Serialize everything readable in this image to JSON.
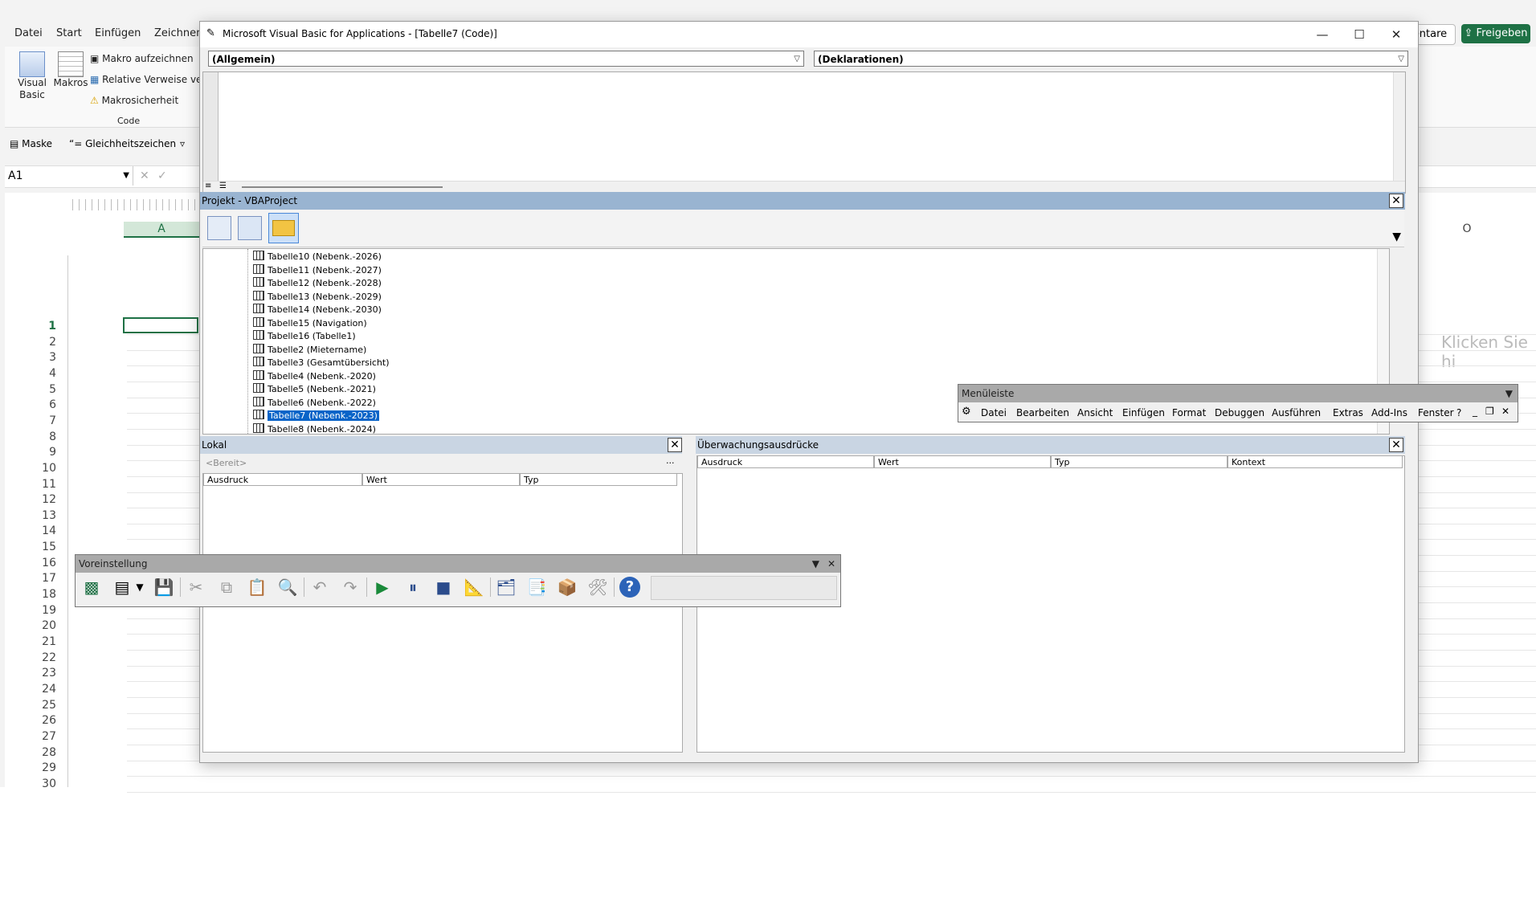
{
  "excel": {
    "tabs": [
      "Datei",
      "Start",
      "Einfügen",
      "Zeichnen"
    ],
    "ribbon": {
      "visual_basic": "Visual\nBasic",
      "makros": "Makros",
      "makro_aufzeichnen": "Makro aufzeichnen",
      "relative_verweise": "Relative Verweise verw",
      "makrosicherheit": "Makrosicherheit",
      "group_code": "Code"
    },
    "quick": {
      "maske": "Maske",
      "gleichheitszeichen": "Gleichheitszeichen"
    },
    "name_box": "A1",
    "column_a": "A",
    "column_o": "O",
    "kommentare": "entare",
    "freigeben": "Freigeben",
    "klicken": "Klicken Sie hi",
    "rows": [
      "1",
      "2",
      "3",
      "4",
      "5",
      "6",
      "7",
      "8",
      "9",
      "10",
      "11",
      "12",
      "13",
      "14",
      "15",
      "16",
      "17",
      "18",
      "19",
      "20",
      "21",
      "22",
      "23",
      "24",
      "25",
      "26",
      "27",
      "28",
      "29",
      "30"
    ]
  },
  "vbe": {
    "title": "Microsoft Visual Basic for Applications - [Tabelle7 (Code)]",
    "combo_left": "(Allgemein)",
    "combo_right": "(Deklarationen)",
    "project": {
      "title": "Projekt - VBAProject",
      "items": [
        "Tabelle10 (Nebenk.-2026)",
        "Tabelle11 (Nebenk.-2027)",
        "Tabelle12 (Nebenk.-2028)",
        "Tabelle13 (Nebenk.-2029)",
        "Tabelle14 (Nebenk.-2030)",
        "Tabelle15 (Navigation)",
        "Tabelle16 (Tabelle1)",
        "Tabelle2 (Mietername)",
        "Tabelle3 (Gesamtübersicht)",
        "Tabelle4 (Nebenk.-2020)",
        "Tabelle5 (Nebenk.-2021)",
        "Tabelle6 (Nebenk.-2022)",
        "Tabelle7 (Nebenk.-2023)",
        "Tabelle8 (Nebenk.-2024)"
      ],
      "selected_index": 12
    },
    "lokal": {
      "title": "Lokal",
      "status": "<Bereit>",
      "dots": "...",
      "columns": [
        "Ausdruck",
        "Wert",
        "Typ"
      ]
    },
    "watch": {
      "title": "Überwachungsausdrücke",
      "columns": [
        "Ausdruck",
        "Wert",
        "Typ",
        "Kontext"
      ]
    }
  },
  "menubar": {
    "title": "Menüleiste",
    "items": [
      "Datei",
      "Bearbeiten",
      "Ansicht",
      "Einfügen",
      "Format",
      "Debuggen",
      "Ausführen",
      "Extras",
      "Add-Ins",
      "Fenster",
      "?"
    ]
  },
  "toolbar": {
    "title": "Voreinstellung"
  }
}
